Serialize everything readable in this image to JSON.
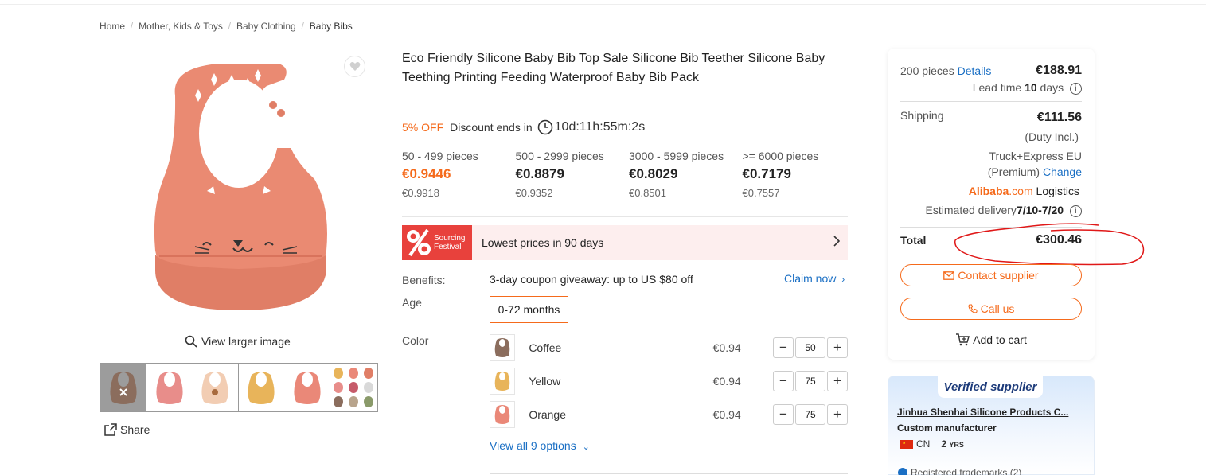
{
  "breadcrumb": [
    "Home",
    "Mother, Kids & Toys",
    "Baby Clothing",
    "Baby Bibs"
  ],
  "gallery": {
    "view_larger": "View larger image",
    "share": "Share",
    "thumbnail_colors": [
      "#8b6d5d",
      "#e88d8a",
      "#f2cdb3",
      "#e8b45a",
      "#ea8878",
      "mixed"
    ]
  },
  "product": {
    "title": "Eco Friendly Silicone Baby Bib Top Sale Silicone Bib Teether Silicone Baby Teething Printing Feeding Waterproof Baby Bib Pack",
    "discount_off": "5% OFF",
    "discount_ends": "Discount ends in",
    "timer": "10d:11h:55m:2s",
    "tiers": [
      {
        "range": "50 - 499 pieces",
        "price": "€0.9446",
        "old": "€0.9918"
      },
      {
        "range": "500 - 2999 pieces",
        "price": "€0.8879",
        "old": "€0.9352"
      },
      {
        "range": "3000 - 5999 pieces",
        "price": "€0.8029",
        "old": "€0.8501"
      },
      {
        "range": ">= 6000 pieces",
        "price": "€0.7179",
        "old": "€0.7557"
      }
    ],
    "festival": {
      "logo_line1": "Sourcing",
      "logo_line2": "Festival",
      "text": "Lowest prices in 90 days"
    },
    "benefits_label": "Benefits:",
    "benefits_text": "3-day coupon giveaway: up to US $80 off",
    "claim": "Claim now",
    "age_label": "Age",
    "age_option": "0-72 months",
    "color_label": "Color",
    "colors": [
      {
        "name": "Coffee",
        "price": "€0.94",
        "qty": "50",
        "swatch": "#8b6d5d"
      },
      {
        "name": "Yellow",
        "price": "€0.94",
        "qty": "75",
        "swatch": "#e8b45a"
      },
      {
        "name": "Orange",
        "price": "€0.94",
        "qty": "75",
        "swatch": "#ea8878"
      }
    ],
    "view_all": "View all 9 options"
  },
  "order": {
    "pieces": "200 pieces",
    "details": "Details",
    "subtotal": "€188.91",
    "lead_time_label": "Lead time",
    "lead_time_value": "10",
    "lead_time_unit": "days",
    "shipping_label": "Shipping",
    "shipping_value": "€111.56",
    "duty": "(Duty Incl.)",
    "method": "Truck+Express EU",
    "premium": "(Premium)",
    "change": "Change",
    "logistics_brand_a": "Alibaba",
    "logistics_brand_b": ".com",
    "logistics_word": "Logistics",
    "est_label": "Estimated delivery",
    "est_value": "7/10-7/20",
    "total_label": "Total",
    "total_value": "€300.46",
    "contact": "Contact supplier",
    "call": "Call us",
    "add_cart": "Add to cart"
  },
  "supplier": {
    "verified": "Verified supplier",
    "name": "Jinhua Shenhai Silicone Products C...",
    "type": "Custom manufacturer",
    "country": "CN",
    "years": "2",
    "years_unit": "YRS",
    "trademarks": "Registered trademarks (2)"
  },
  "colors": {
    "accent": "#f56a1b",
    "link": "#1a6fc4",
    "annotation": "#e01818",
    "bib": "#ea8a72"
  }
}
